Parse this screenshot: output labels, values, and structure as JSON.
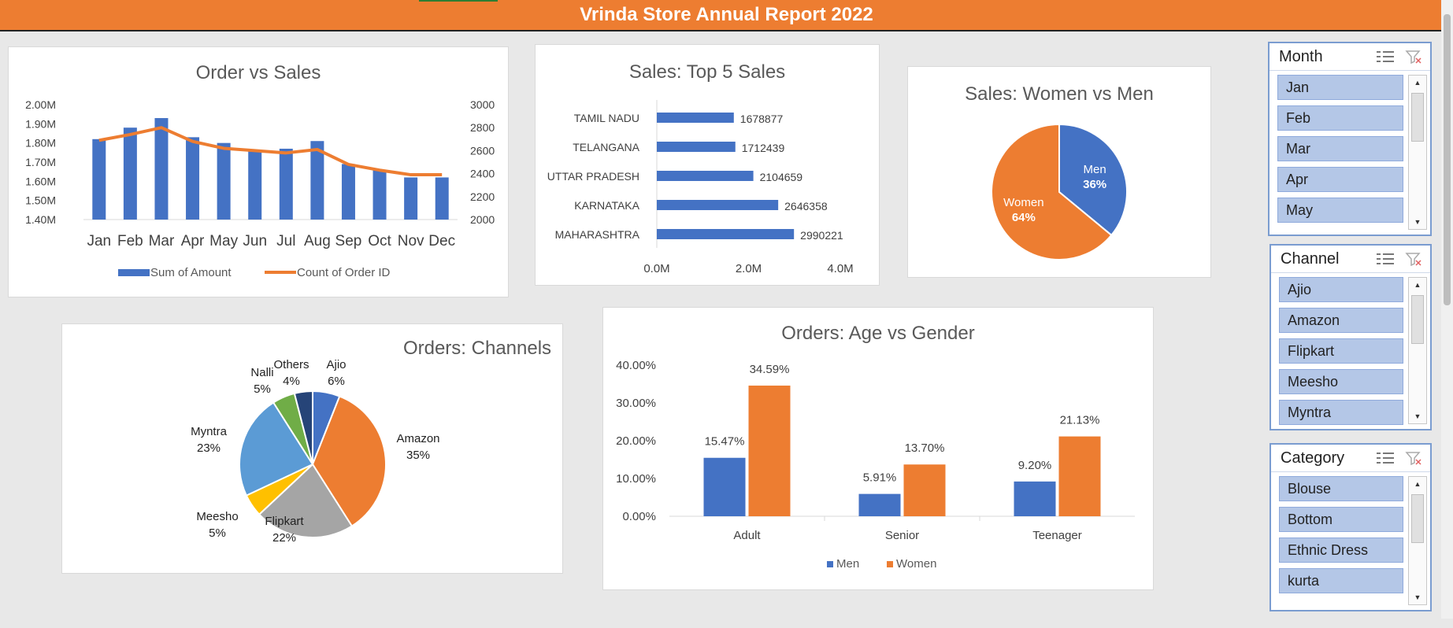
{
  "report_title": "Vrinda Store Annual Report 2022",
  "chart_data": [
    {
      "id": "order-vs-sales",
      "type": "bar",
      "title": "Order vs Sales",
      "categories": [
        "Jan",
        "Feb",
        "Mar",
        "Apr",
        "May",
        "Jun",
        "Jul",
        "Aug",
        "Sep",
        "Oct",
        "Nov",
        "Dec"
      ],
      "series": [
        {
          "name": "Sum of Amount",
          "type": "bar",
          "axis": "left",
          "color": "#4472c4",
          "values": [
            1820000,
            1880000,
            1930000,
            1830000,
            1800000,
            1760000,
            1770000,
            1810000,
            1690000,
            1660000,
            1620000,
            1620000
          ]
        },
        {
          "name": "Count of Order ID",
          "type": "line",
          "axis": "right",
          "color": "#ed7d31",
          "values": [
            2690,
            2740,
            2800,
            2680,
            2620,
            2600,
            2580,
            2610,
            2480,
            2430,
            2390,
            2390
          ]
        }
      ],
      "left_axis": {
        "ylim": [
          1400000,
          2000000
        ],
        "ticks": [
          "2.00M",
          "1.90M",
          "1.80M",
          "1.70M",
          "1.60M",
          "1.50M",
          "1.40M"
        ]
      },
      "right_axis": {
        "ylim": [
          2000,
          3000
        ],
        "ticks": [
          "3000",
          "2800",
          "2600",
          "2400",
          "2200",
          "2000"
        ]
      },
      "legend": "bottom"
    },
    {
      "id": "top5-sales",
      "type": "bar",
      "orientation": "horizontal",
      "title": "Sales: Top 5 Sales",
      "categories": [
        "TAMIL NADU",
        "TELANGANA",
        "UTTAR PRADESH",
        "KARNATAKA",
        "MAHARASHTRA"
      ],
      "values": [
        1678877,
        1712439,
        2104659,
        2646358,
        2990221
      ],
      "data_labels": [
        "1678877",
        "1712439",
        "2104659",
        "2646358",
        "2990221"
      ],
      "xlim": [
        0,
        4000000
      ],
      "xticks": [
        "0.0M",
        "2.0M",
        "4.0M"
      ],
      "color": "#4472c4"
    },
    {
      "id": "women-vs-men",
      "type": "pie",
      "title": "Sales: Women vs Men",
      "slices": [
        {
          "label": "Men",
          "value": 36,
          "text": "36%",
          "color": "#4472c4"
        },
        {
          "label": "Women",
          "value": 64,
          "text": "64%",
          "color": "#ed7d31"
        }
      ]
    },
    {
      "id": "orders-channels",
      "type": "pie",
      "title": "Orders: Channels",
      "slices": [
        {
          "label": "Ajio",
          "value": 6,
          "text": "6%",
          "color": "#4472c4"
        },
        {
          "label": "Amazon",
          "value": 35,
          "text": "35%",
          "color": "#ed7d31"
        },
        {
          "label": "Flipkart",
          "value": 22,
          "text": "22%",
          "color": "#a5a5a5"
        },
        {
          "label": "Meesho",
          "value": 5,
          "text": "5%",
          "color": "#ffc000"
        },
        {
          "label": "Myntra",
          "value": 23,
          "text": "23%",
          "color": "#5b9bd5"
        },
        {
          "label": "Nalli",
          "value": 5,
          "text": "5%",
          "color": "#70ad47"
        },
        {
          "label": "Others",
          "value": 4,
          "text": "4%",
          "color": "#264478"
        }
      ]
    },
    {
      "id": "age-vs-gender",
      "type": "bar",
      "title": "Orders: Age vs Gender",
      "categories": [
        "Adult",
        "Senior",
        "Teenager"
      ],
      "series": [
        {
          "name": "Men",
          "color": "#4472c4",
          "values": [
            15.47,
            5.91,
            9.2
          ],
          "labels": [
            "15.47%",
            "5.91%",
            "9.20%"
          ]
        },
        {
          "name": "Women",
          "color": "#ed7d31",
          "values": [
            34.59,
            13.7,
            21.13
          ],
          "labels": [
            "34.59%",
            "13.70%",
            "21.13%"
          ]
        }
      ],
      "ylim": [
        0,
        40
      ],
      "yticks": [
        "40.00%",
        "30.00%",
        "20.00%",
        "10.00%",
        "0.00%"
      ],
      "legend": "bottom"
    }
  ],
  "slicers": [
    {
      "id": "month",
      "title": "Month",
      "items": [
        "Jan",
        "Feb",
        "Mar",
        "Apr",
        "May"
      ]
    },
    {
      "id": "channel",
      "title": "Channel",
      "items": [
        "Ajio",
        "Amazon",
        "Flipkart",
        "Meesho",
        "Myntra"
      ]
    },
    {
      "id": "category",
      "title": "Category",
      "items": [
        "Blouse",
        "Bottom",
        "Ethnic Dress",
        "kurta"
      ]
    }
  ],
  "icons": {
    "multi_select": "multi-select-icon",
    "clear_filter": "clear-filter-icon",
    "scroll_up": "scroll-up-icon",
    "scroll_down": "scroll-down-icon"
  },
  "colors": {
    "accent": "#ed7d31",
    "primary": "#4472c4",
    "slicer_item": "#b4c7e7"
  }
}
